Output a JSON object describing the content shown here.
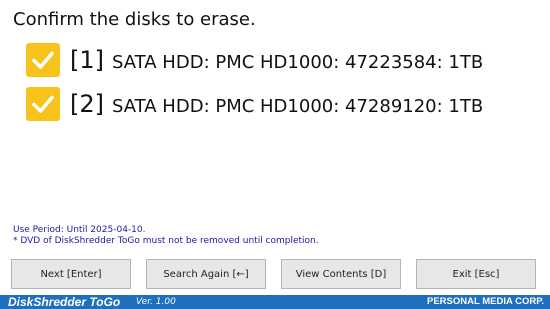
{
  "heading": "Confirm the disks to erase.",
  "disks": [
    {
      "index": "[1]",
      "label": "SATA HDD: PMC HD1000: 47223584: 1TB",
      "checked": true
    },
    {
      "index": "[2]",
      "label": "SATA HDD: PMC HD1000: 47289120: 1TB",
      "checked": true
    }
  ],
  "notice": {
    "use_period": "Use Period: Until 2025-04-10.",
    "dvd_warning": "* DVD of DiskShredder ToGo must not be removed until completion."
  },
  "buttons": {
    "next": "Next [Enter]",
    "search_again": "Search Again [←]",
    "view_contents": "View Contents [D]",
    "exit": "Exit [Esc]"
  },
  "footer": {
    "brand_main": "DiskShredder ",
    "brand_togo": "ToGo",
    "version": "Ver. 1.00",
    "company": "PERSONAL MEDIA CORP."
  },
  "colors": {
    "checkbox": "#f7c31b",
    "footer_bar": "#1f6fbf",
    "notice_text": "#1a1aa0"
  }
}
